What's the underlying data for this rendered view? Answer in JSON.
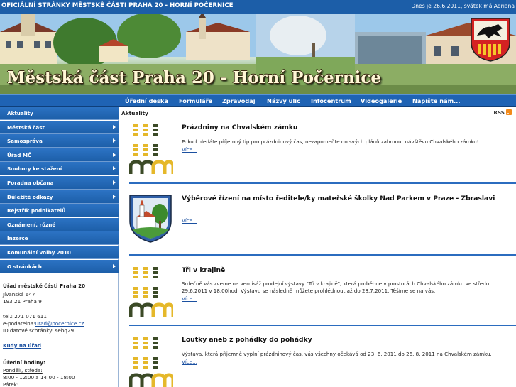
{
  "header": {
    "site_title": "OFICIÁLNÍ STRÁNKY MĚSTSKÉ ČÁSTI PRAHA 20 - HORNÍ POČERNICE",
    "date_line": "Dnes je 26.6.2011, svátek má Adriana"
  },
  "banner": {
    "title": "Městská část Praha 20 - Horní Počernice"
  },
  "nav": {
    "items": [
      "Úřední deska",
      "Formuláře",
      "Zpravodaj",
      "Názvy ulic",
      "Infocentrum",
      "Videogalerie",
      "Napište nám..."
    ]
  },
  "sidebar": {
    "items": [
      {
        "label": "Aktuality",
        "has_submenu": false
      },
      {
        "label": "Městská část",
        "has_submenu": true
      },
      {
        "label": "Samospráva",
        "has_submenu": true
      },
      {
        "label": "Úřad MČ",
        "has_submenu": true
      },
      {
        "label": "Soubory ke stažení",
        "has_submenu": true
      },
      {
        "label": "Poradna občana",
        "has_submenu": true
      },
      {
        "label": "Důležité odkazy",
        "has_submenu": true
      },
      {
        "label": "Rejstřík podnikatelů",
        "has_submenu": false
      },
      {
        "label": "Oznámení, různé",
        "has_submenu": false
      },
      {
        "label": "Inzerce",
        "has_submenu": false
      },
      {
        "label": "Komunální volby 2010",
        "has_submenu": false
      },
      {
        "label": "O stránkách",
        "has_submenu": true
      }
    ],
    "contact": {
      "office_name": "Úřad městské části Praha 20",
      "street": "Jívanská 647",
      "city": "193 21 Praha 9",
      "phone": "tel.: 271 071 611",
      "email_label": "e-podatelna:",
      "email": "urad@pocernice.cz",
      "data_box": "ID datové schránky: sebq29",
      "directions_link": "Kudy na úřad",
      "hours_title": "Úřední hodiny:",
      "days_1": "Pondělí, středa:",
      "hours_1": "8:00 - 12:00 a 14:00 - 18:00",
      "days_2": "Pátek:"
    }
  },
  "main": {
    "breadcrumb": "Aktuality",
    "rss_label": "RSS",
    "more_label": "Více...",
    "articles": [
      {
        "title": "Prázdniny na Chvalském zámku",
        "text": "Pokud hledáte příjemný tip pro prázdninový čas, nezapomeňte do svých plánů zahrnout návštěvu Chvalského zámku!",
        "image": "chvalsky-zamek-logo"
      },
      {
        "title": "Výběrové řízení na místo ředitele/ky mateřské školky Nad Parkem v Praze - Zbraslavi",
        "text": "",
        "image": "coat-of-arms"
      },
      {
        "title": "Tři v krajině",
        "text": "Srdečně vás zveme na vernisáž prodejní výstavy \"Tři v krajině\", která proběhne v prostorách Chvalského zámku ve středu 29.6.2011 v 18.00hod. Výstavu se následně můžete prohlédnout až do 28.7.2011. Těšíme se na vás.",
        "image": "chvalsky-zamek-logo"
      },
      {
        "title": "Loutky aneb z pohádky do pohádky",
        "text": "Výstava, která příjemně vyplní prázdninový čas, vás všechny očekává od 23. 6. 2011 do 26. 8. 2011 na Chvalském zámku.",
        "image": "chvalsky-zamek-logo"
      }
    ]
  },
  "colors": {
    "header_blue": "#1c5ea8",
    "menu_blue": "#1d5fa9",
    "divider_blue": "#2b6cbf",
    "logo_gold": "#e5b82a",
    "logo_dark": "#3b4a26"
  }
}
